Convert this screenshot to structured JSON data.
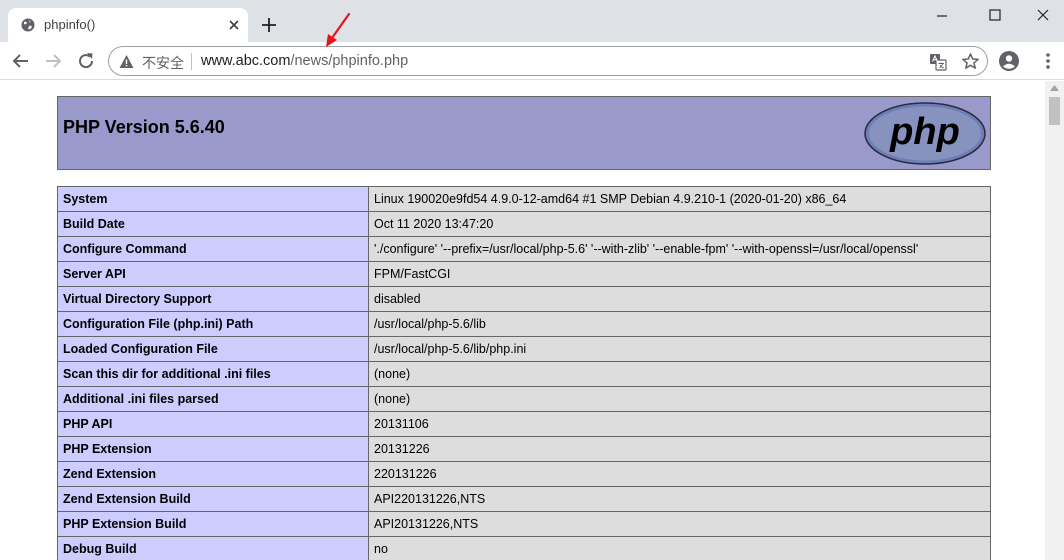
{
  "browser": {
    "tab": {
      "title": "phpinfo()"
    },
    "omnibox": {
      "security_label": "不安全",
      "url_host": "www.abc.com",
      "url_path": "/news/phpinfo.php"
    },
    "icons": [
      "globe-icon",
      "close-icon",
      "plus-icon",
      "minimize-icon",
      "maximize-icon",
      "window-close-icon",
      "back-arrow-icon",
      "forward-arrow-icon",
      "reload-icon",
      "warning-icon",
      "translate-icon",
      "star-icon",
      "profile-icon",
      "kebab-menu-icon"
    ],
    "colors": {
      "tabstrip": "#dee1e6",
      "annotation_arrow": "#e8141b"
    }
  },
  "page": {
    "header": {
      "version": "PHP Version 5.6.40",
      "logo_text": "php"
    },
    "colors": {
      "header_bg": "#9999cc",
      "key_bg": "#ccccff",
      "value_bg": "#dddddd"
    },
    "rows": [
      {
        "key": "System",
        "value": "Linux 190020e9fd54 4.9.0-12-amd64 #1 SMP Debian 4.9.210-1 (2020-01-20) x86_64"
      },
      {
        "key": "Build Date",
        "value": "Oct 11 2020 13:47:20"
      },
      {
        "key": "Configure Command",
        "value": "'./configure' '--prefix=/usr/local/php-5.6' '--with-zlib' '--enable-fpm' '--with-openssl=/usr/local/openssl'"
      },
      {
        "key": "Server API",
        "value": "FPM/FastCGI"
      },
      {
        "key": "Virtual Directory Support",
        "value": "disabled"
      },
      {
        "key": "Configuration File (php.ini) Path",
        "value": "/usr/local/php-5.6/lib"
      },
      {
        "key": "Loaded Configuration File",
        "value": "/usr/local/php-5.6/lib/php.ini"
      },
      {
        "key": "Scan this dir for additional .ini files",
        "value": "(none)"
      },
      {
        "key": "Additional .ini files parsed",
        "value": "(none)"
      },
      {
        "key": "PHP API",
        "value": "20131106"
      },
      {
        "key": "PHP Extension",
        "value": "20131226"
      },
      {
        "key": "Zend Extension",
        "value": "220131226"
      },
      {
        "key": "Zend Extension Build",
        "value": "API220131226,NTS"
      },
      {
        "key": "PHP Extension Build",
        "value": "API20131226,NTS"
      },
      {
        "key": "Debug Build",
        "value": "no"
      }
    ]
  }
}
